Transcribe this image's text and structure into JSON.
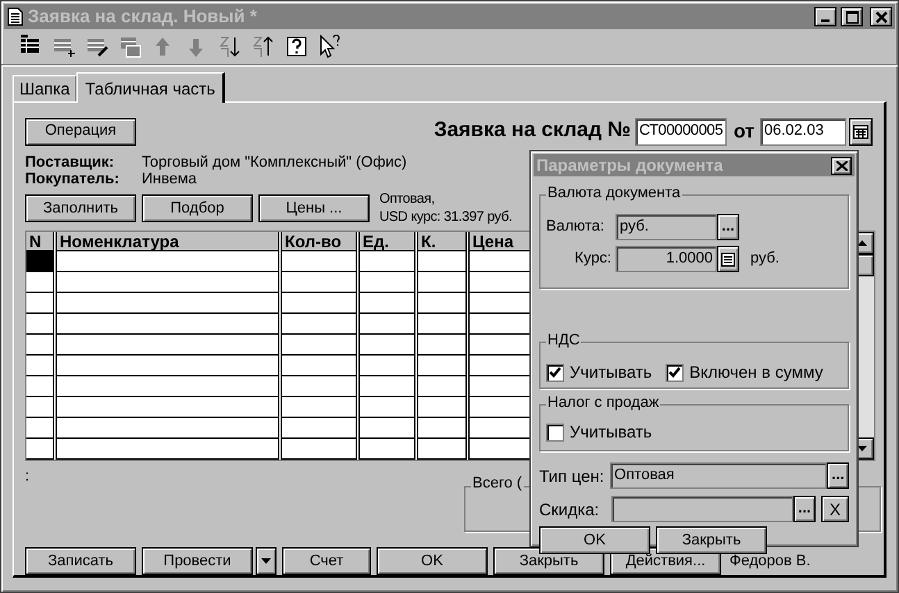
{
  "window": {
    "title": "Заявка на склад. Новый *"
  },
  "tabs": [
    {
      "label": "Шапка",
      "selected": false
    },
    {
      "label": "Табличная часть",
      "selected": true
    }
  ],
  "header": {
    "operation_button": "Операция",
    "doc_label": "Заявка на склад №",
    "number": "СТ00000005",
    "date_label": "от",
    "date": "06.02.03"
  },
  "parties": [
    {
      "label": "Поставщик:",
      "value": "Торговый дом \"Комплексный\" (Офис)"
    },
    {
      "label": "Покупатель:",
      "value": "Инвема"
    }
  ],
  "table_buttons": [
    "Заполнить",
    "Подбор",
    "Цены ..."
  ],
  "price_info": [
    "Оптовая,",
    "USD курс: 31.397 руб."
  ],
  "table": {
    "columns": [
      "N",
      "Номенклатура",
      "Кол-во",
      "Ед.",
      "К.",
      "Цена"
    ]
  },
  "footer_mark": ":",
  "totals_group": "Всего (",
  "bottom_buttons": [
    "Записать",
    "Провести",
    "Счет",
    "OK",
    "Закрыть",
    "Действия..."
  ],
  "author": "Федоров В.",
  "dialog": {
    "title": "Параметры документа",
    "currency_group": {
      "title": "Валюта документа",
      "currency_label": "Валюта:",
      "currency": "руб.",
      "currency_button": "...",
      "rate_label": "Курс:",
      "rate": "1.0000",
      "rate_unit": "руб."
    },
    "vat_group": {
      "title": "НДС",
      "checks": [
        {
          "label": "Учитывать",
          "checked": true
        },
        {
          "label": "Включен в сумму",
          "checked": true
        }
      ]
    },
    "sales_tax_group": {
      "title": "Налог с продаж",
      "checks": [
        {
          "label": "Учитывать",
          "checked": false
        }
      ]
    },
    "price_type_label": "Тип цен:",
    "price_type": "Оптовая",
    "price_type_button": "...",
    "discount_label": "Скидка:",
    "discount_button": "...",
    "clear_button": "X",
    "buttons": [
      "OK",
      "Закрыть"
    ]
  }
}
